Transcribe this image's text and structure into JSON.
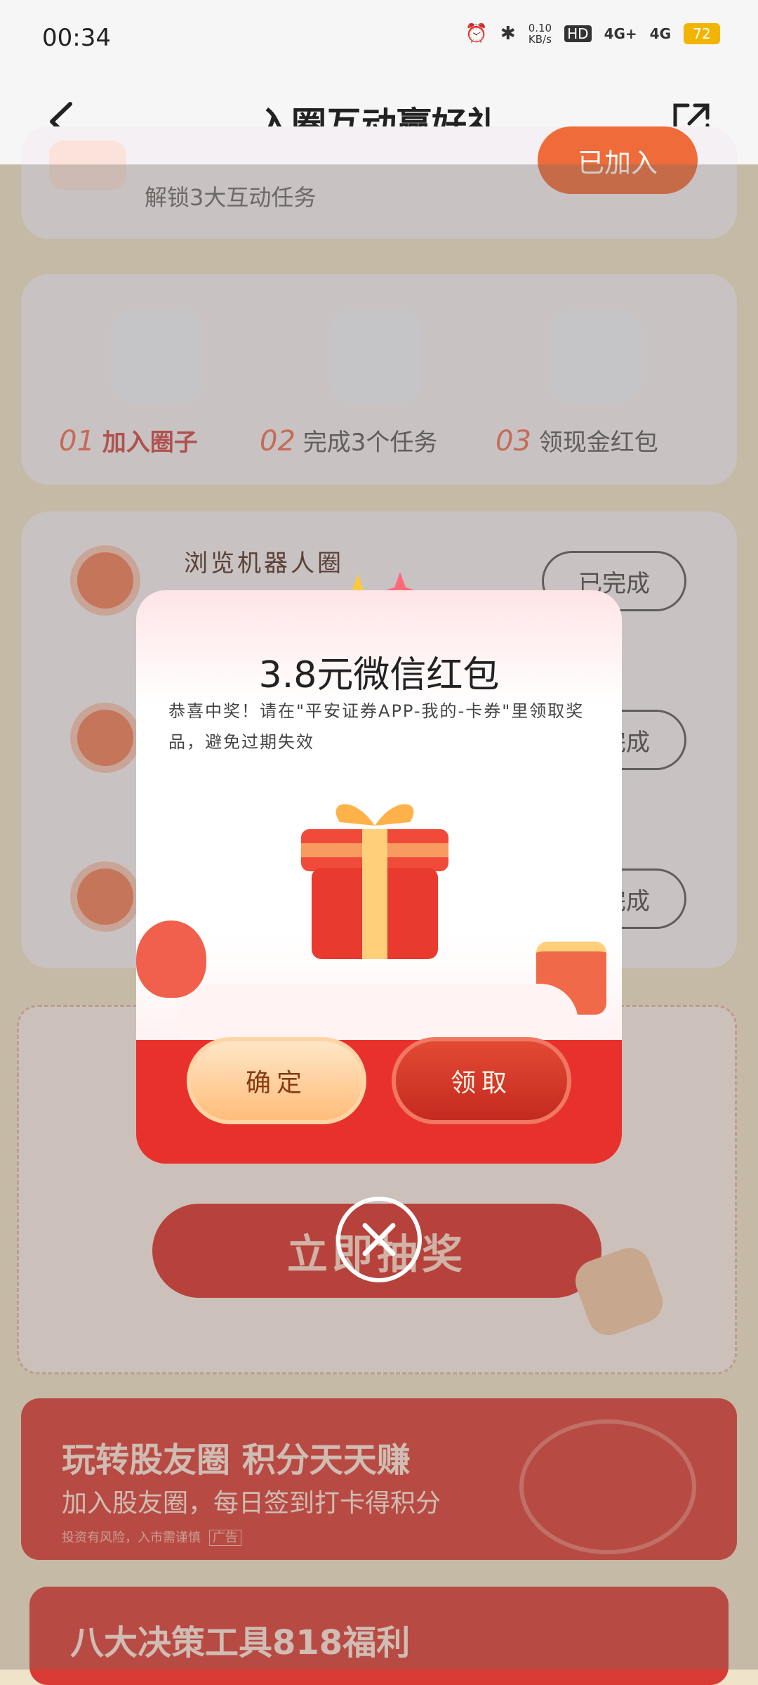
{
  "status_bar": {
    "time": "00:34",
    "speed_value": "0.10",
    "speed_unit": "KB/s",
    "network_hd": "HD",
    "sim1": "4G+",
    "sim2": "4G",
    "battery": "72"
  },
  "header": {
    "title": "入圈互动赢好礼"
  },
  "page": {
    "top_card": {
      "subtitle": "解锁3大互动任务",
      "button": "已加入"
    },
    "steps": [
      {
        "num": "01",
        "label": "加入圈子"
      },
      {
        "num": "02",
        "label": "完成3个任务"
      },
      {
        "num": "03",
        "label": "领现金红包"
      }
    ],
    "tasks": [
      {
        "title": "浏览机器人圈",
        "status": "已完成"
      },
      {
        "title": "",
        "status": "已完成"
      },
      {
        "title": "",
        "status": "已完成"
      }
    ],
    "lottery_button": "立即抽奖",
    "banner1": {
      "title": "玩转股友圈 积分天天赚",
      "subtitle": "加入股友圈，每日签到打卡得积分",
      "disclaimer": "投资有风险，入市需谨慎",
      "ad_tag": "广告"
    },
    "banner2": {
      "title": "八大决策工具818福利"
    }
  },
  "modal": {
    "title": "3.8元微信红包",
    "message": "恭喜中奖！请在\"平安证券APP-我的-卡券\"里领取奖品，避免过期失效",
    "confirm_label": "确定",
    "claim_label": "领取"
  },
  "colors": {
    "accent_red": "#e8312d",
    "step_orange": "#ef6b52",
    "confirm_gradient": "#ffbd7a"
  },
  "icons": [
    "back-icon",
    "share-icon",
    "alarm-icon",
    "bluetooth-icon",
    "gift-box-icon",
    "close-icon",
    "trend-icon"
  ]
}
